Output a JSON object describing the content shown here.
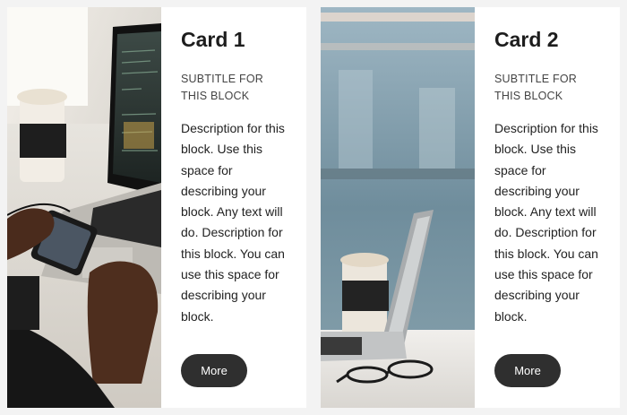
{
  "cards": [
    {
      "image": "photo-laptop-phone-coffee",
      "title": "Card 1",
      "subtitle": "SUBTITLE FOR THIS BLOCK",
      "description": "Description for this block. Use this space for describing your block. Any text will do. Description for this block. You can use this space for describing your block.",
      "button_label": "More"
    },
    {
      "image": "photo-laptop-coffee-glasses",
      "title": "Card 2",
      "subtitle": "SUBTITLE FOR THIS BLOCK",
      "description": "Description for this block. Use this space for describing your block. Any text will do. Description for this block. You can use this space for describing your block.",
      "button_label": "More"
    }
  ],
  "colors": {
    "page_background": "#f3f3f3",
    "card_background": "#ffffff",
    "button_background": "#2f2f2f",
    "button_text": "#ffffff"
  }
}
